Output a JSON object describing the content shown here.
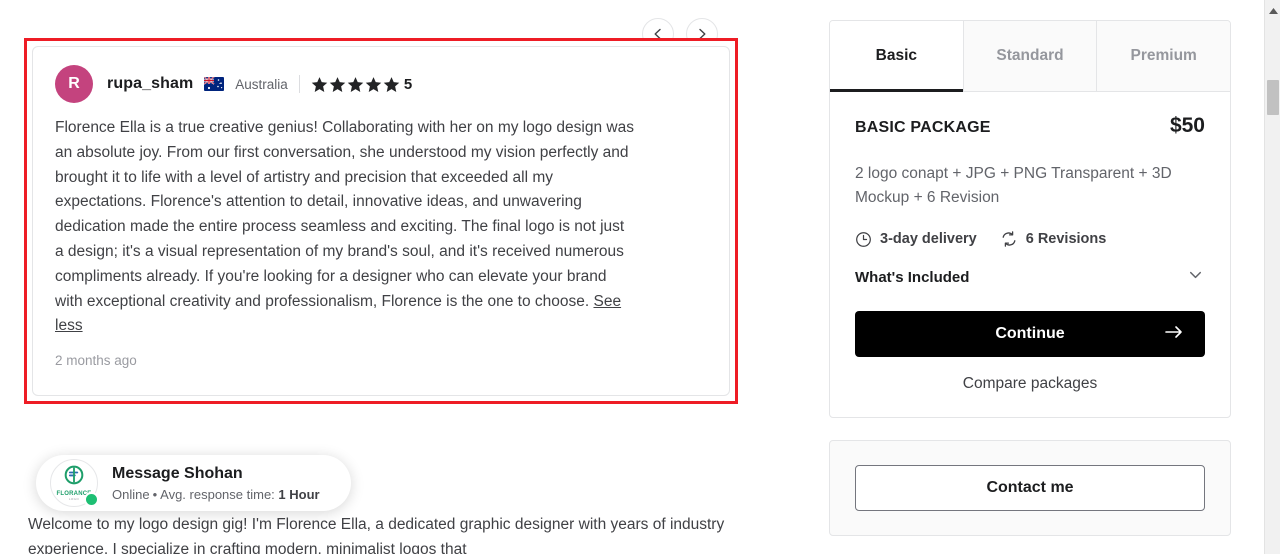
{
  "review_nav": {
    "prev_label": "‹",
    "next_label": "›"
  },
  "review": {
    "avatar_initial": "R",
    "avatar_color": "#c4437e",
    "reviewer_name": "rupa_sham",
    "country": "Australia",
    "country_flag": "australia-flag",
    "stars": 5,
    "rating_value": "5",
    "body": "Florence Ella is a true creative genius! Collaborating with her on my logo design was an absolute joy. From our first conversation, she understood my vision perfectly and brought it to life with a level of artistry and precision that exceeded all my expectations. Florence's attention to detail, innovative ideas, and unwavering dedication made the entire process seamless and exciting. The final logo is not just a design; it's a visual representation of my brand's soul, and it's received numerous compliments already. If you're looking for a designer who can elevate your brand with exceptional creativity and professionalism, Florence is the one to choose. ",
    "see_less_label": "See less",
    "date": "2 months ago",
    "highlight_color": "#ee1c25"
  },
  "message_widget": {
    "title": "Message Shohan",
    "status": "Online",
    "separator": "•",
    "response_prefix": "Avg. response time: ",
    "response_time": "1 Hour",
    "logo_text": "FLORANCE",
    "logo_sub": "LOGO",
    "online_color": "#1dbf73"
  },
  "gig_description": "Welcome to my logo design gig! I'm Florence Ella, a dedicated graphic designer with years of industry experience. I specialize in crafting modern, minimalist logos that",
  "package": {
    "tabs": [
      {
        "label": "Basic",
        "active": true
      },
      {
        "label": "Standard",
        "active": false
      },
      {
        "label": "Premium",
        "active": false
      }
    ],
    "name": "BASIC PACKAGE",
    "price": "$50",
    "description": "2 logo conapt + JPG + PNG Transparent + 3D Mockup + 6 Revision",
    "delivery": "3-day delivery",
    "revisions": "6 Revisions",
    "whats_included_label": "What's Included",
    "continue_label": "Continue",
    "compare_label": "Compare packages"
  },
  "contact": {
    "button_label": "Contact me"
  }
}
